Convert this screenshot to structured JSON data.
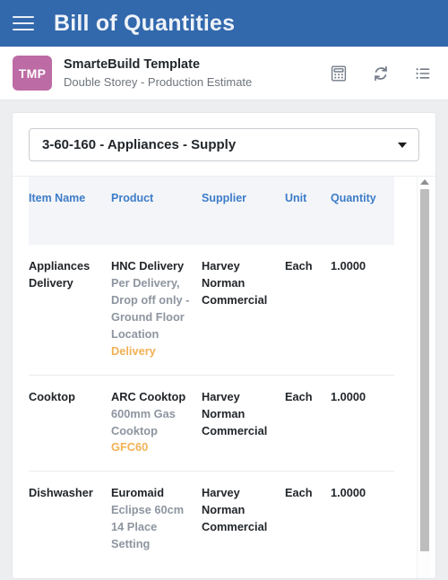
{
  "appbar": {
    "menu_icon": "hamburger-menu-icon",
    "title": "Bill of Quantities",
    "background_color": "#3268ac"
  },
  "subheader": {
    "avatar_initials": "TMP",
    "avatar_color": "#bd6ba4",
    "project_title": "SmarteBuild Template",
    "project_subtitle": "Double Storey - Production Estimate",
    "actions": [
      {
        "icon": "calculator-icon",
        "label": "Calculator"
      },
      {
        "icon": "refresh-sync-icon",
        "label": "Refresh"
      },
      {
        "icon": "list-icon",
        "label": "List"
      }
    ]
  },
  "section_select": {
    "value": "3-60-160 - Appliances - Supply",
    "caret_icon": "chevron-down-icon"
  },
  "table": {
    "columns": [
      "Item Name",
      "Product",
      "Supplier",
      "Unit",
      "Quantity"
    ],
    "rows": [
      {
        "item_name": "Appliances Delivery",
        "product_name": "HNC Delivery",
        "product_desc": "Per Delivery, Drop off only - Ground Floor Location",
        "product_code": "Delivery",
        "supplier": "Harvey Norman Commercial",
        "unit": "Each",
        "quantity": "1.0000"
      },
      {
        "item_name": "Cooktop",
        "product_name": "ARC Cooktop",
        "product_desc": "600mm Gas Cooktop",
        "product_code": "GFC60",
        "supplier": "Harvey Norman Commercial",
        "unit": "Each",
        "quantity": "1.0000"
      },
      {
        "item_name": "Dishwasher",
        "product_name": "Euromaid",
        "product_desc": "Eclipse 60cm 14 Place Setting",
        "product_code": "",
        "supplier": "Harvey Norman Commercial",
        "unit": "Each",
        "quantity": "1.0000"
      }
    ]
  },
  "scrollbar": {
    "up_arrow_icon": "scroll-up-arrow-icon"
  },
  "colors": {
    "header_blue": "#3268ac",
    "accent_link": "#3d7cc9",
    "code_amber": "#f2b155",
    "muted_text": "#8d95a0"
  }
}
